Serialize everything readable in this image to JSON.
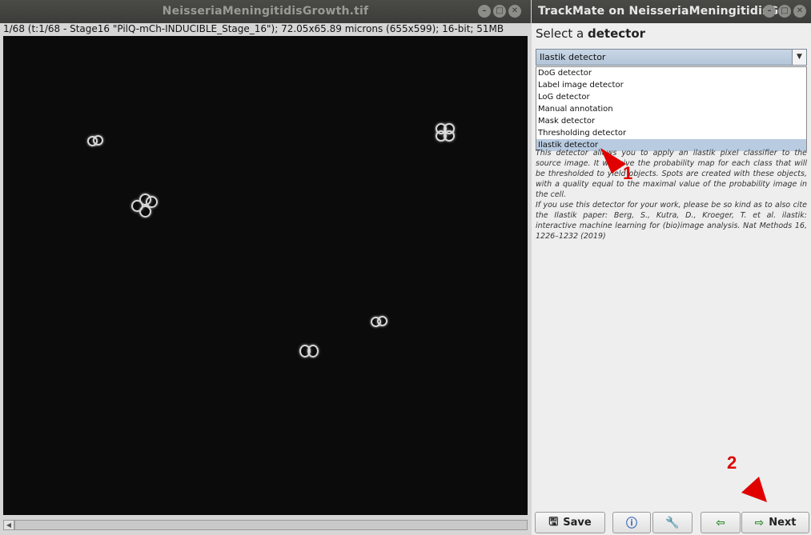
{
  "image_window": {
    "title": "NeisseriaMeningitidisGrowth.tif",
    "info": "1/68 (t:1/68 - Stage16 \"PilQ-mCh-INDUCIBLE_Stage_16\"); 72.05x65.89 microns (655x599); 16-bit; 51MB"
  },
  "trackmate": {
    "title": "TrackMate on NeisseriaMeningitidisG...",
    "heading_prefix": "Select a",
    "heading_bold": "detector",
    "selected": "Ilastik detector",
    "options": [
      "DoG detector",
      "Label image detector",
      "LoG detector",
      "Manual annotation",
      "Mask detector",
      "Thresholding detector",
      "Ilastik detector"
    ],
    "description_1": "This detector allows you to apply an ilastik pixel classifier to the source image. It will give the probability map for each class that will be thresholded to yield objects. Spots are created with these objects, with a quality equal to the maximal value of the probability image in the cell.",
    "description_2": "If you use this detector for your work, please be so kind as to also cite the Ilastik paper: Berg, S., Kutra, D., Kroeger, T. et al. ilastik: interactive machine learning for (bio)image analysis. Nat Methods 16, 1226–1232 (2019)",
    "buttons": {
      "save": "Save",
      "next": "Next"
    }
  },
  "annotations": {
    "step1": "1",
    "step2": "2",
    "color": "#e00000"
  }
}
